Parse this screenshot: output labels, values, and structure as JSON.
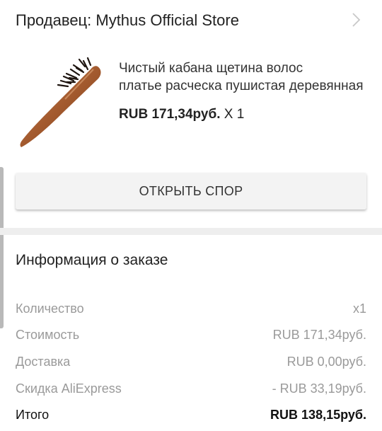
{
  "seller": {
    "label": "Продавец: Mythus Official Store"
  },
  "product": {
    "title_line1": "Чистый кабана щетина волос",
    "title_line2": "платье расческа пушистая деревянная",
    "price": "RUB 171,34руб.",
    "quantity": " X 1"
  },
  "dispute_button": {
    "label": "ОТКРЫТЬ СПОР"
  },
  "order_info": {
    "title": "Информация о заказе",
    "rows": [
      {
        "label": "Количество",
        "value": "x1"
      },
      {
        "label": "Стоимость",
        "value": "RUB 171,34руб."
      },
      {
        "label": "Доставка",
        "value": "RUB 0,00руб."
      },
      {
        "label": "Скидка AliExpress",
        "value": "- RUB 33,19руб."
      },
      {
        "label": "Итого",
        "value": "RUB 138,15руб."
      }
    ]
  },
  "colors": {
    "muted_text": "#9a9a9a",
    "divider": "#eeeeee",
    "button_bg": "#f3f3f3"
  },
  "icons": [
    "chevron-right-icon"
  ]
}
